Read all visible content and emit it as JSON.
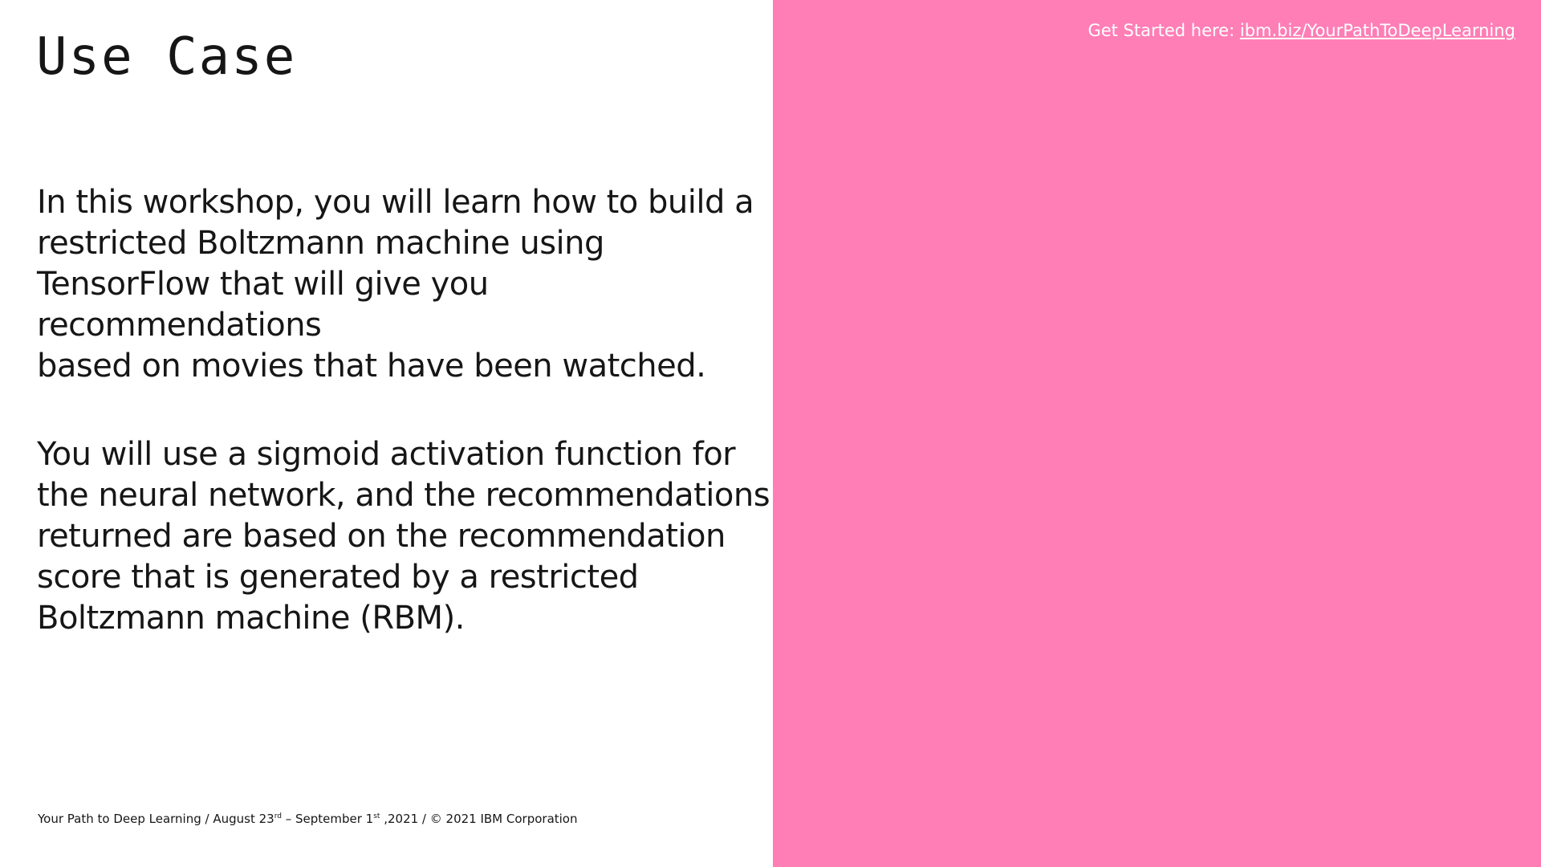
{
  "slide": {
    "title": "Use Case",
    "paragraphs": [
      "In this workshop, you will learn how to build a\nrestricted Boltzmann machine using\nTensorFlow that will give you recommendations\nbased on movies that have been watched.",
      "You will  use a sigmoid activation function for\nthe neural network, and the recommendations\nreturned are based on the recommendation\nscore that is generated by a restricted\nBoltzmann machine (RBM)."
    ],
    "get_started": {
      "label": "Get Started here: ",
      "link_text": "ibm.biz/YourPathToDeepLearning"
    },
    "footer": {
      "part1": "Your Path to Deep Learning / August 23",
      "sup1": "rd",
      "part2": " – September 1",
      "sup2": "st",
      "part3": " ,2021 / © 2021 IBM Corporation"
    }
  },
  "colors": {
    "panel": "#ff7eb6",
    "text": "#161616",
    "background": "#ffffff"
  }
}
